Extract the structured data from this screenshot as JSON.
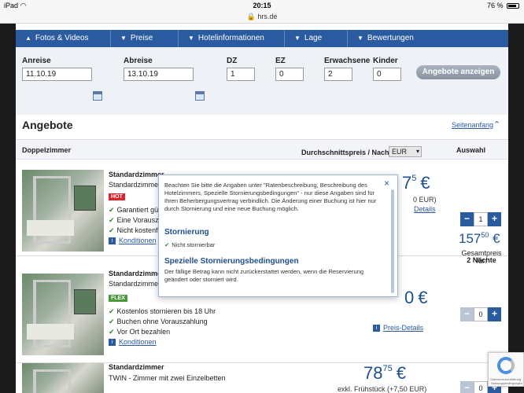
{
  "statusbar": {
    "device": "iPad",
    "wifi": "wifi-icon",
    "time": "20:15",
    "battery": "76 %",
    "url": "hrs.de"
  },
  "nav": {
    "tabs": [
      {
        "label": "Fotos & Videos"
      },
      {
        "label": "Preise"
      },
      {
        "label": "Hotelinformationen"
      },
      {
        "label": "Lage"
      },
      {
        "label": "Bewertungen"
      }
    ]
  },
  "search": {
    "anreise_label": "Anreise",
    "anreise_value": "11.10.19",
    "abreise_label": "Abreise",
    "abreise_value": "13.10.19",
    "dz_label": "DZ",
    "dz_value": "1",
    "ez_label": "EZ",
    "ez_value": "0",
    "erwachsene_label": "Erwachsene",
    "erwachsene_value": "2",
    "kinder_label": "Kinder",
    "kinder_value": "0",
    "button": "Angebote anzeigen"
  },
  "offers_header": {
    "title": "Angebote",
    "seitenanfang": "Seitenanfang"
  },
  "table_header": {
    "room": "Doppelzimmer",
    "avg_price": "Durchschnittspreis / Nacht",
    "currency": "EUR",
    "auswahl": "Auswahl"
  },
  "offers": [
    {
      "title": "Standardzimmer",
      "subtitle": "Standardzimmer",
      "tag": "HOT",
      "features": [
        "Garantiert gün",
        "Eine Vorauszal",
        "Nicht kostenfr"
      ],
      "conditions": "Konditionen",
      "price_int": "7",
      "price_dec": "5",
      "currency_sym": "€",
      "price_note": "0 EUR)",
      "details": "Details",
      "qty": "1",
      "total_int": "157",
      "total_dec": "50",
      "total_sym": "€",
      "total_label_1": "Gesamtpreis für:",
      "total_label_2": "2 Nächte"
    },
    {
      "title": "Standardzimmer",
      "subtitle": "Standardzimmer",
      "tag": "FLEX",
      "features": [
        "Kostenlos stornieren bis 18 Uhr",
        "Buchen ohne Vorauszahlung",
        "Vor Ort bezahlen"
      ],
      "conditions": "Konditionen",
      "price_int": "0",
      "price_dec": "",
      "currency_sym": "€",
      "price_note": "",
      "details": "Preis-Details",
      "qty": "0"
    },
    {
      "title": "Standardzimmer",
      "subtitle": "TWIN - Zimmer mit zwei Einzelbetten",
      "price_int": "78",
      "price_dec": "75",
      "currency_sym": "€",
      "price_note": "exkl. Frühstück (+7,50 EUR)",
      "qty": "0"
    }
  ],
  "popover": {
    "close": "×",
    "text": "Beachten Sie bitte die Angaben unter \"Ratenbeschreibung, Beschreibung des Hotelzimmers, Spezielle Stornierungsbedingungen\" - nur diese Angaben sind für Ihren Beherbergungsvertrag verbindlich. Die Änderung einer Buchung ist hier nur durch Stornierung und eine neue Buchung möglich.",
    "storno_head": "Stornierung",
    "storno_note": "Nicht stornierbar",
    "special_head": "Spezielle Stornierungsbedingungen",
    "special_text": "Der fällige Betrag kann nicht zurückerstattet werden, wenn die Reservierung geändert oder storniert wird."
  },
  "recaptcha": {
    "text": "Datenschutzerklärung · Nutzungsbedingungen"
  },
  "colors": {
    "brand_blue": "#2a5aa0",
    "price_blue": "#1e4f8e",
    "hot": "#d7262e",
    "flex": "#4a9a3a"
  }
}
